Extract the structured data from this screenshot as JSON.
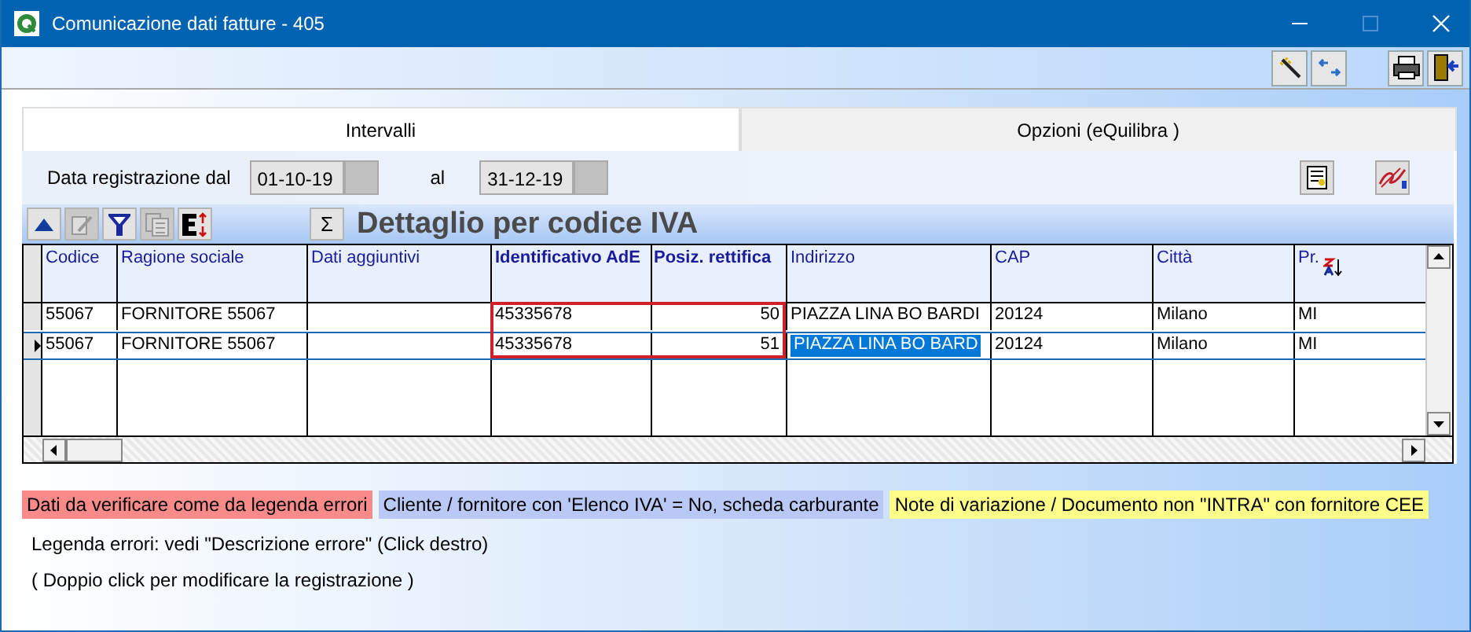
{
  "window": {
    "title": "Comunicazione dati fatture - 405"
  },
  "toolbar": [
    {
      "kind": "wand"
    },
    {
      "kind": "swap"
    },
    {
      "kind": "printer"
    },
    {
      "kind": "exit"
    }
  ],
  "tabs": [
    {
      "label": "Intervalli",
      "selected": true
    },
    {
      "label": "Opzioni (eQuilibra )",
      "selected": false
    }
  ],
  "date_range": {
    "from_label": "Data registrazione dal",
    "from": "01-10-19",
    "to_label": "al",
    "to": "31-12-19"
  },
  "panel_tools": [
    {
      "kind": "report"
    },
    {
      "kind": "sign"
    }
  ],
  "grid_tools": [
    {
      "kind": "up",
      "disabled": false
    },
    {
      "kind": "edit",
      "disabled": true
    },
    {
      "kind": "filter",
      "disabled": false
    },
    {
      "kind": "copy",
      "disabled": true
    },
    {
      "kind": "export",
      "disabled": false
    }
  ],
  "sum_button": "Σ",
  "grid_title": "Dettaglio per codice IVA",
  "columns": [
    {
      "label": "Codice",
      "bold": false,
      "kind": "text",
      "sorted": false,
      "current": false
    },
    {
      "label": "Ragione sociale",
      "bold": false,
      "kind": "text",
      "sorted": false,
      "current": false
    },
    {
      "label": "Dati aggiuntivi",
      "bold": false,
      "kind": "text",
      "sorted": false,
      "current": false
    },
    {
      "label": "Identificativo AdE",
      "bold": true,
      "kind": "text",
      "sorted": false,
      "current": false
    },
    {
      "label": "Posiz. rettifica",
      "bold": true,
      "kind": "number",
      "sorted": false,
      "current": false
    },
    {
      "label": "Indirizzo",
      "bold": false,
      "kind": "text",
      "sorted": false,
      "current": true
    },
    {
      "label": "CAP",
      "bold": false,
      "kind": "text",
      "sorted": false,
      "current": false
    },
    {
      "label": "Città",
      "bold": false,
      "kind": "text",
      "sorted": false,
      "current": false
    },
    {
      "label": "Pr.",
      "bold": false,
      "kind": "text",
      "sorted": true,
      "current": false
    }
  ],
  "rows": [
    {
      "selected": false,
      "cells": [
        "55067",
        "FORNITORE 55067",
        "",
        "45335678",
        "50",
        "PIAZZA LINA BO BARDI",
        "20124",
        "Milano",
        "MI"
      ]
    },
    {
      "selected": true,
      "cells": [
        "55067",
        "FORNITORE 55067",
        "",
        "45335678",
        "51",
        "PIAZZA LINA BO BARD",
        "20124",
        "Milano",
        "MI"
      ]
    }
  ],
  "legend": [
    {
      "label": "Dati da verificare come da legenda errori",
      "color": "#f88a8a"
    },
    {
      "label": "Cliente / fornitore con 'Elenco IVA' = No, scheda carburante",
      "color": "#b9c8f5"
    },
    {
      "label": "Note di variazione / Documento non \"INTRA\" con fornitore CEE",
      "color": "#fdfd8a"
    }
  ],
  "notes": [
    "Legenda errori: vedi \"Descrizione errore\" (Click destro)",
    "( Doppio click per modificare la registrazione )"
  ]
}
